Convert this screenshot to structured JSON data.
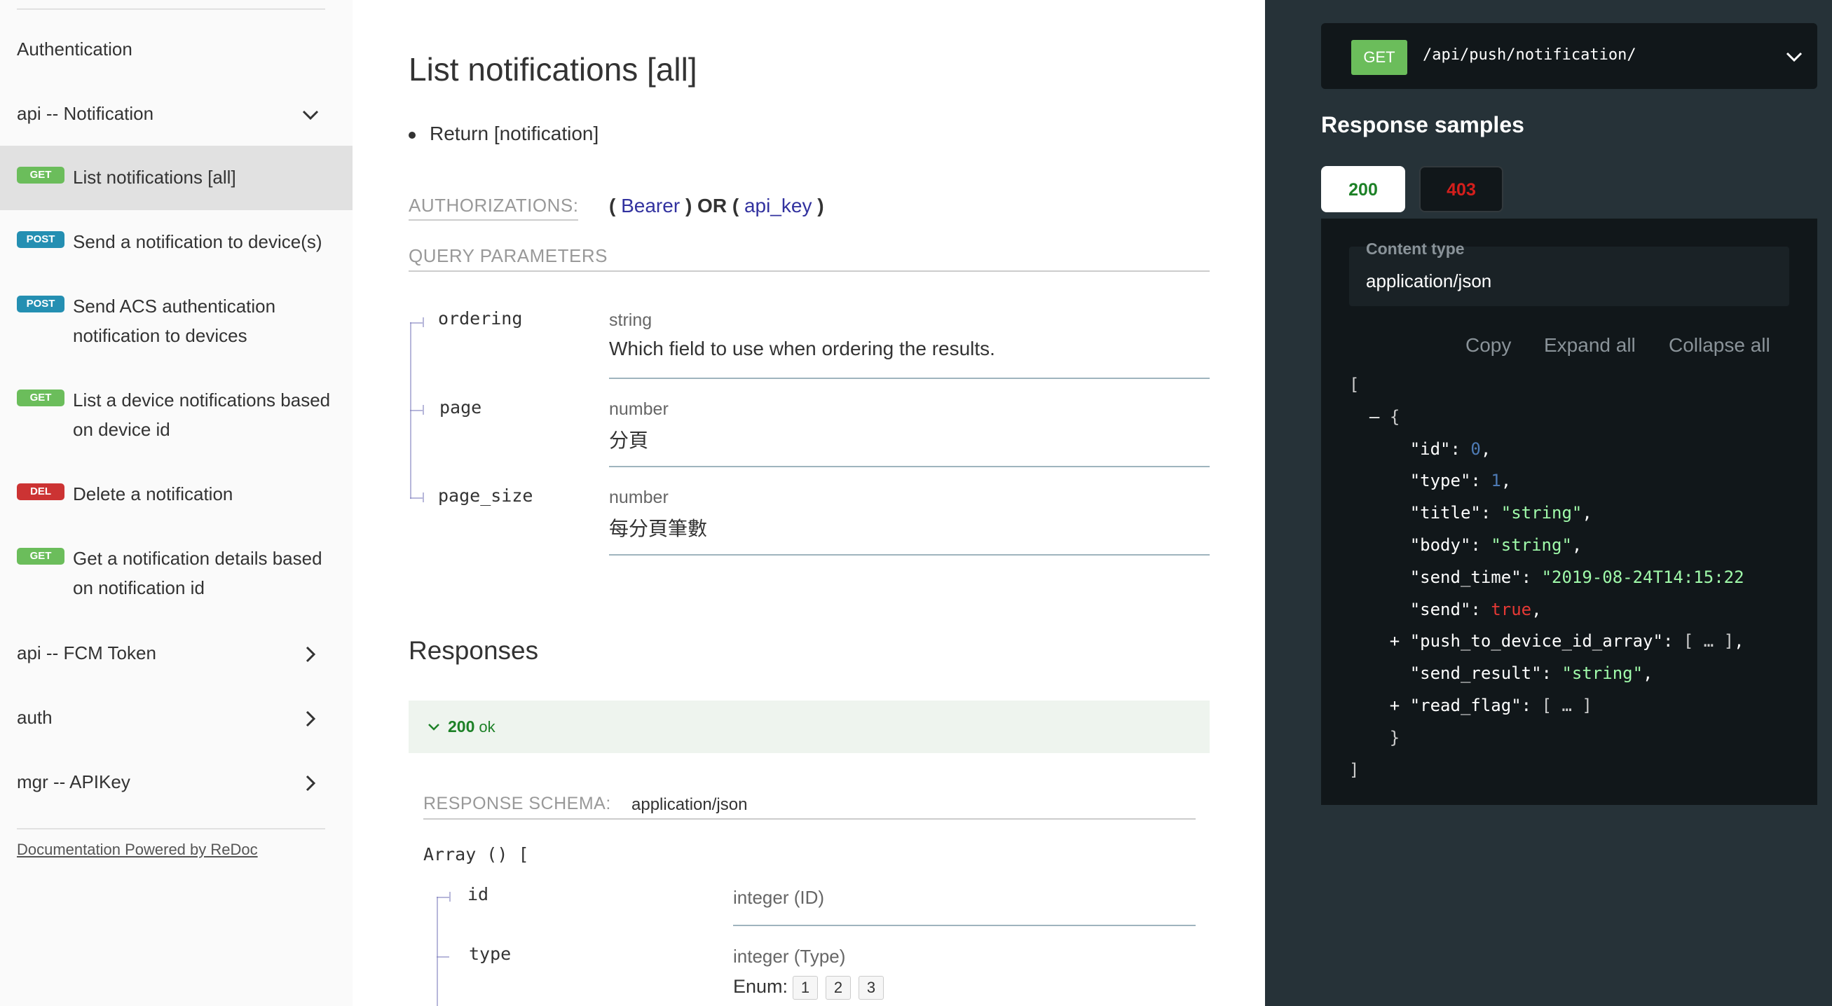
{
  "sidebar": {
    "groups": [
      {
        "label": "Authentication"
      },
      {
        "label": "api -- Notification"
      },
      {
        "label": "api -- FCM Token"
      },
      {
        "label": "auth"
      },
      {
        "label": "mgr -- APIKey"
      }
    ],
    "items": [
      {
        "method": "GET",
        "label": "List notifications [all]"
      },
      {
        "method": "POST",
        "label": "Send a notification to device(s)"
      },
      {
        "method": "POST",
        "label": "Send ACS authentication notification to devices"
      },
      {
        "method": "GET",
        "label": "List a device notifications based on device id"
      },
      {
        "method": "DEL",
        "label": "Delete a notification"
      },
      {
        "method": "GET",
        "label": "Get a notification details based on notification id"
      }
    ],
    "footer": "Documentation Powered by ReDoc"
  },
  "main": {
    "title": "List notifications [all]",
    "bullet": "Return [notification]",
    "authorizations_label": "AUTHORIZATIONS:",
    "auth": {
      "open1": "(",
      "bearer": "Bearer",
      "close_or": ") OR (",
      "api_key": "api_key",
      "close2": ")"
    },
    "query_params_label": "QUERY PARAMETERS",
    "params": [
      {
        "name": "ordering",
        "type": "string",
        "desc": "Which field to use when ordering the results."
      },
      {
        "name": "page",
        "type": "number",
        "desc": "分頁"
      },
      {
        "name": "page_size",
        "type": "number",
        "desc": "每分頁筆數"
      }
    ],
    "responses_title": "Responses",
    "response": {
      "code": "200",
      "text": "ok"
    },
    "response_schema_label": "RESPONSE SCHEMA:",
    "response_schema_type": "application/json",
    "array_open": "Array () [",
    "schema_fields": [
      {
        "name": "id",
        "type": "integer (ID)"
      },
      {
        "name": "type",
        "type": "integer (Type)"
      }
    ],
    "enum_label": "Enum:",
    "enum_values": [
      "1",
      "2",
      "3"
    ]
  },
  "right": {
    "method": "GET",
    "path": "/api/push/notification/",
    "samples_title": "Response samples",
    "tabs": [
      "200",
      "403"
    ],
    "content_type_label": "Content type",
    "content_type": "application/json",
    "controls": [
      "Copy",
      "Expand all",
      "Collapse all"
    ],
    "json": {
      "open_bracket": "[",
      "minus": "–",
      "open_brace": "{",
      "id_key": "\"id\"",
      "id_val": "0",
      "type_key": "\"type\"",
      "type_val": "1",
      "title_key": "\"title\"",
      "title_val": "\"string\"",
      "body_key": "\"body\"",
      "body_val": "\"string\"",
      "send_time_key": "\"send_time\"",
      "send_time_val": "\"2019-08-24T14:15:22",
      "send_key": "\"send\"",
      "send_val": "true",
      "plus": "+",
      "push_key": "\"push_to_device_id_array\"",
      "collapsed": "[ … ]",
      "send_result_key": "\"send_result\"",
      "send_result_val": "\"string\"",
      "read_flag_key": "\"read_flag\"",
      "close_brace": "}",
      "close_bracket": "]"
    }
  },
  "colors": {
    "get": "#6bbd5b",
    "post": "#248fb2",
    "delete": "#cc3333",
    "right_bg": "#263238",
    "accent_link": "#32329f",
    "success": "#1d8127",
    "error": "#d41f1c"
  },
  "icons": {
    "chevron_down": "chevron-down-icon",
    "chevron_right": "chevron-right-icon"
  }
}
